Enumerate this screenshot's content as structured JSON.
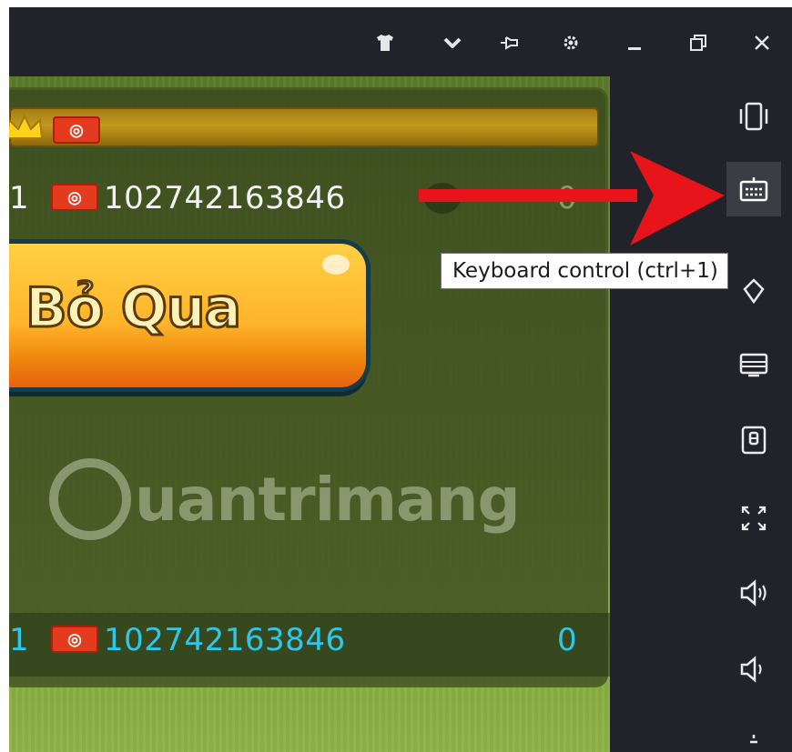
{
  "titlebar": {
    "icons": [
      "shirt-icon",
      "chevron-down-icon",
      "pin-icon",
      "gear-icon",
      "minimize-icon",
      "restore-icon",
      "close-icon"
    ]
  },
  "game": {
    "row1": {
      "rank": "1",
      "player_id": "102742163846",
      "score": "0"
    },
    "row2": {
      "rank": "1",
      "player_id": "102742163846",
      "score": "0"
    },
    "skip_button": "Bỏ Qua",
    "watermark": "uantrimang"
  },
  "sidebar": {
    "icons": [
      "shake-phone-icon",
      "keyboard-control-icon",
      "location-icon",
      "screen-icon",
      "apk-install-icon",
      "fullscreen-icon",
      "volume-up-icon",
      "volume-down-icon"
    ],
    "tooltip": "Keyboard control (ctrl+1)"
  },
  "colors": {
    "accent_red": "#e8141b",
    "window_bg": "#22232a",
    "row2_text": "#2ec7ea"
  }
}
